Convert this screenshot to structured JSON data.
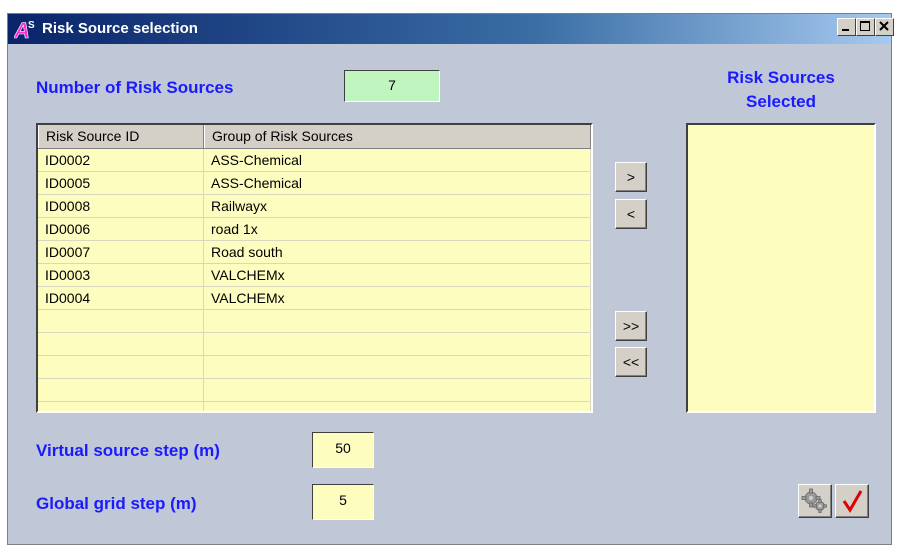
{
  "window": {
    "title": "Risk Source selection",
    "logo_text": "A",
    "logo_superscript": "S"
  },
  "count": {
    "label": "Number of Risk Sources",
    "value": "7"
  },
  "table": {
    "columns": [
      "Risk Source ID",
      "Group of Risk Sources"
    ],
    "rows": [
      {
        "id": "ID0002",
        "group": "ASS-Chemical"
      },
      {
        "id": "ID0005",
        "group": "ASS-Chemical"
      },
      {
        "id": "ID0008",
        "group": "Railwayx"
      },
      {
        "id": "ID0006",
        "group": "road 1x"
      },
      {
        "id": "ID0007",
        "group": "Road south"
      },
      {
        "id": "ID0003",
        "group": "VALCHEMx"
      },
      {
        "id": "ID0004",
        "group": "VALCHEMx"
      }
    ]
  },
  "move_buttons": {
    "add_one": ">",
    "remove_one": "<",
    "add_all": ">>",
    "remove_all": "<<"
  },
  "selected": {
    "title_line1": "Risk Sources",
    "title_line2": "Selected",
    "items": []
  },
  "virtual_step": {
    "label": "Virtual source step (m)",
    "value": "50"
  },
  "grid_step": {
    "label": "Global grid step (m)",
    "value": "5"
  },
  "icons": {
    "settings": "gears-icon",
    "ok": "checkmark-icon"
  },
  "colors": {
    "label_blue": "#1a1aff",
    "count_field_bg": "#c0f5c0",
    "yellow_bg": "#fdfdc0",
    "window_bg": "#c0c8d8",
    "check_red": "#e00000"
  }
}
